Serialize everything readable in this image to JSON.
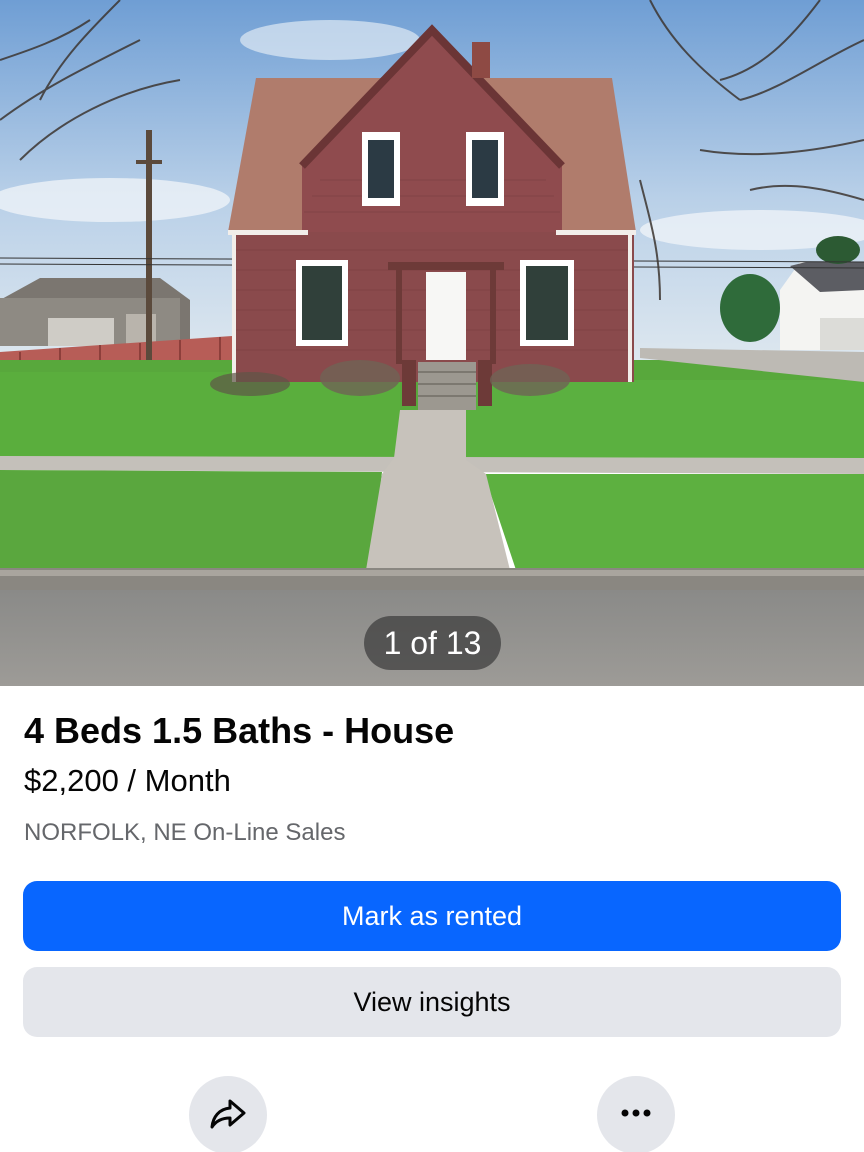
{
  "listing": {
    "photo_counter": "1 of 13",
    "title": "4 Beds 1.5 Baths - House",
    "price": "$2,200 / Month",
    "location": "NORFOLK, NE On-Line Sales"
  },
  "actions": {
    "primary_label": "Mark as rented",
    "secondary_label": "View insights",
    "share_icon": "share-arrow-icon",
    "more_icon": "more-options-icon"
  },
  "colors": {
    "primary": "#0866ff",
    "secondary_bg": "#e4e6eb",
    "muted_text": "#65676b",
    "house_siding": "#8a4a4c",
    "roof": "#b07c6c"
  }
}
